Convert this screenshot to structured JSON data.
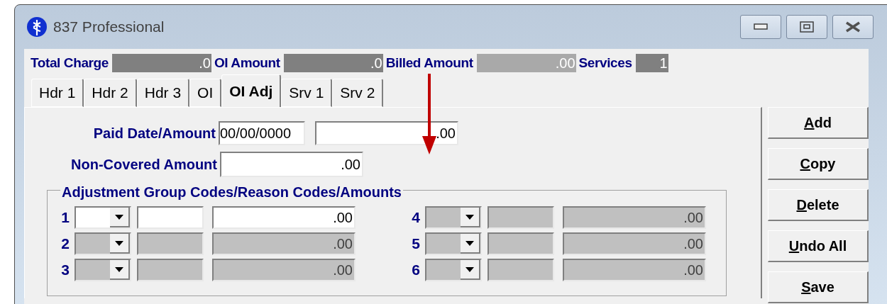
{
  "window": {
    "title": "837 Professional"
  },
  "summary": [
    {
      "label": "Total Charge",
      "value": ".0",
      "color": "#808080"
    },
    {
      "label": "OI Amount",
      "value": ".0",
      "color": "#808080"
    },
    {
      "label": "Billed Amount",
      "value": ".00",
      "color": "#a9a9a9"
    },
    {
      "label": "Services",
      "value": "1",
      "color": "#808080"
    }
  ],
  "tabs": [
    {
      "label": "Hdr 1",
      "selected": false
    },
    {
      "label": "Hdr 2",
      "selected": false
    },
    {
      "label": "Hdr 3",
      "selected": false
    },
    {
      "label": "OI",
      "selected": false
    },
    {
      "label": "OI Adj",
      "selected": true
    },
    {
      "label": "Srv 1",
      "selected": false
    },
    {
      "label": "Srv 2",
      "selected": false
    }
  ],
  "paid": {
    "label": "Paid Date/Amount",
    "date": "00/00/0000",
    "amount": ".00"
  },
  "non_covered": {
    "label": "Non-Covered Amount",
    "amount": ".00"
  },
  "adjustments": {
    "title": "Adjustment Group Codes/Reason Codes/Amounts",
    "rows": [
      {
        "number": "1",
        "amount": ".00",
        "disabled": false
      },
      {
        "number": "2",
        "amount": ".00",
        "disabled": true
      },
      {
        "number": "3",
        "amount": ".00",
        "disabled": true
      },
      {
        "number": "4",
        "amount": ".00",
        "disabled": true
      },
      {
        "number": "5",
        "amount": ".00",
        "disabled": true
      },
      {
        "number": "6",
        "amount": ".00",
        "disabled": true
      }
    ]
  },
  "buttons": [
    "Add",
    "Copy",
    "Delete",
    "Undo All",
    "Save"
  ]
}
